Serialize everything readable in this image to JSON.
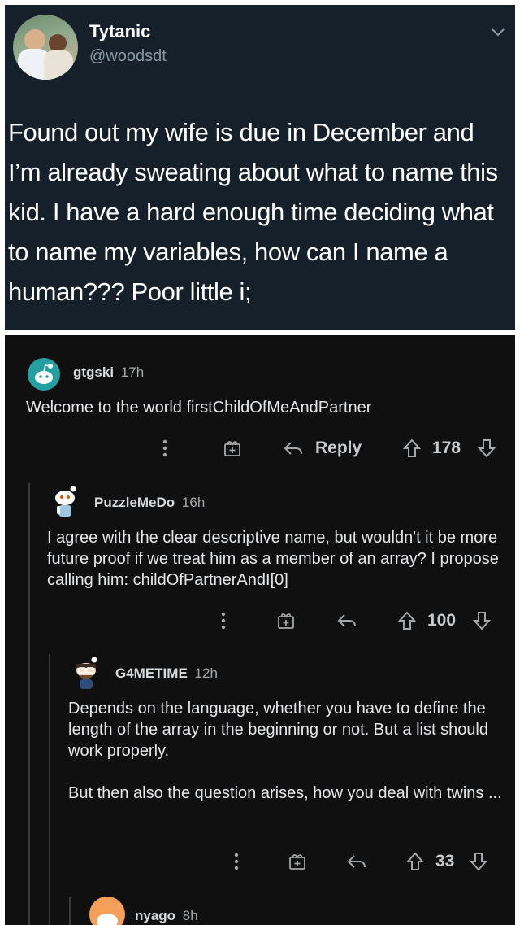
{
  "tweet": {
    "display_name": "Tytanic",
    "handle": "@woodsdt",
    "text": "Found out my wife is due in December and I’m already sweating about what to name this kid.  I have a hard enough time deciding what to name my variables, how can I name a human??? Poor little i;",
    "icons": [
      "avatar-photo",
      "chevron-down-icon"
    ]
  },
  "comments": [
    {
      "user": "gtgski",
      "time": "17h",
      "text": "Welcome to the world firstChildOfMeAndPartner",
      "reply_label": "Reply",
      "votes": "178"
    },
    {
      "user": "PuzzleMeDo",
      "time": "16h",
      "text": "I agree with the clear descriptive name, but wouldn't it be more future proof if we treat him as a member of an array? I propose calling him: childOfPartnerAndI[0]",
      "votes": "100"
    },
    {
      "user": "G4METIME",
      "time": "12h",
      "text_1": "Depends on the language, whether you have to define the length of the array in the beginning or not. But a list should work properly.",
      "text_2": "But then also the question arises, how you deal with twins ...",
      "votes": "33"
    },
    {
      "user": "nyago",
      "time": "8h"
    }
  ],
  "colors": {
    "tweet_bg": "#15202b",
    "reddit_bg": "#101011",
    "snoo_teal": "#24a0a0"
  }
}
